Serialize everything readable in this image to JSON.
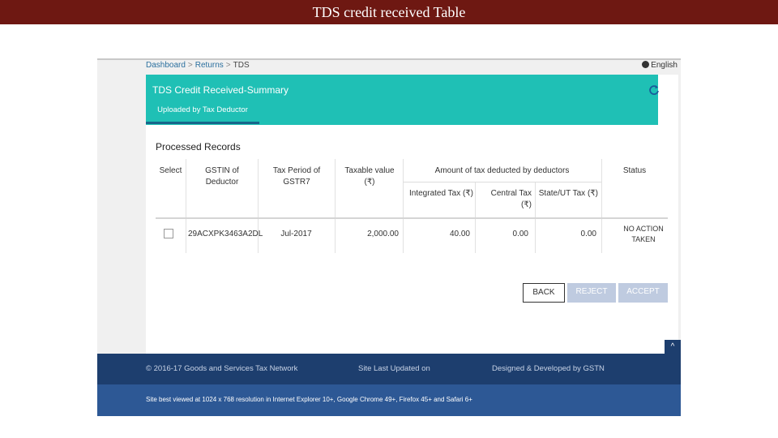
{
  "slide": {
    "title": "TDS  credit received Table"
  },
  "breadcrumb": {
    "items": [
      "Dashboard",
      "Returns",
      "TDS"
    ],
    "separator": ">"
  },
  "language": {
    "label": "English"
  },
  "panel": {
    "title": "TDS Credit Received-Summary",
    "tab": "Uploaded by Tax Deductor",
    "section_title": "Processed Records"
  },
  "table": {
    "headers": {
      "select": "Select",
      "gstin": "GSTIN of Deductor",
      "tax_period": "Tax Period of GSTR7",
      "taxable_value": "Taxable value (₹)",
      "amount_group": "Amount of tax deducted by deductors",
      "integrated_tax": "Integrated Tax (₹)",
      "central_tax": "Central Tax (₹)",
      "state_ut_tax": "State/UT Tax (₹)",
      "status": "Status"
    },
    "rows": [
      {
        "gstin": "29ACXPK3463A2DL",
        "tax_period": "Jul-2017",
        "taxable_value": "2,000.00",
        "integrated_tax": "40.00",
        "central_tax": "0.00",
        "state_ut_tax": "0.00",
        "status": "NO ACTION TAKEN"
      }
    ]
  },
  "buttons": {
    "back": "BACK",
    "reject": "REJECT",
    "accept": "ACCEPT"
  },
  "footer": {
    "copyright": "© 2016-17 Goods and Services Tax Network",
    "updated": "Site Last Updated on",
    "designed": "Designed & Developed by GSTN",
    "best_viewed": "Site best viewed at 1024 x 768 resolution in Internet Explorer 10+, Google Chrome 49+, Firefox 45+ and Safari 6+"
  },
  "colors": {
    "slide_title_bg": "#6e1812",
    "panel_header": "#1fc0b5",
    "footer_dark": "#1d3e6e",
    "footer_light": "#2d5895",
    "disabled_button": "#bfcbe0"
  },
  "icons": {
    "refresh": "refresh-icon",
    "globe": "globe-icon",
    "scroll_top": "chevron-up-icon"
  }
}
